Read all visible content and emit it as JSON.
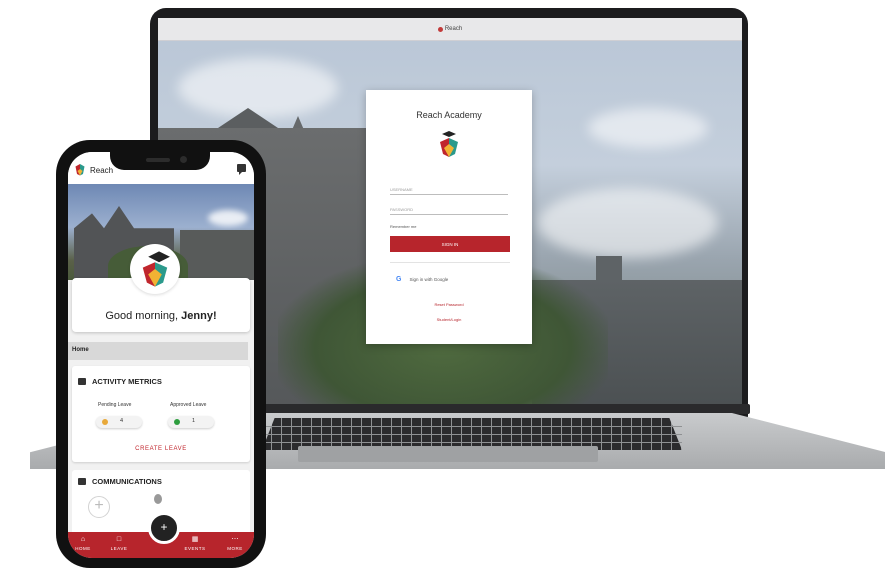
{
  "laptop": {
    "browser_tab": "Reach",
    "login": {
      "title": "Reach Academy",
      "username_placeholder": "USERNAME",
      "password_placeholder": "PASSWORD",
      "remember_label": "Remember me",
      "signin_label": "SIGN IN",
      "google_label": "Sign in with Google",
      "reset_link": "Reset Password",
      "other_link": "Student/Login"
    }
  },
  "phone": {
    "app_name": "Reach",
    "greeting_prefix": "Good morning, ",
    "greeting_name": "Jenny!",
    "home_label": "Home",
    "activity": {
      "title": "ACTIVITY METRICS",
      "pending_label": "Pending Leave",
      "pending_value": "4",
      "approved_label": "Approved Leave",
      "approved_value": "1",
      "create_leave": "CREATE LEAVE"
    },
    "communications": {
      "title": "COMMUNICATIONS"
    },
    "nav": {
      "home": "HOME",
      "leave": "LEAVE",
      "events": "EVENTS",
      "more": "MORE",
      "fab": "+"
    },
    "colors": {
      "brand_red": "#b7252c",
      "pending_dot": "#e8a93b",
      "approved_dot": "#2e9e3f"
    }
  }
}
